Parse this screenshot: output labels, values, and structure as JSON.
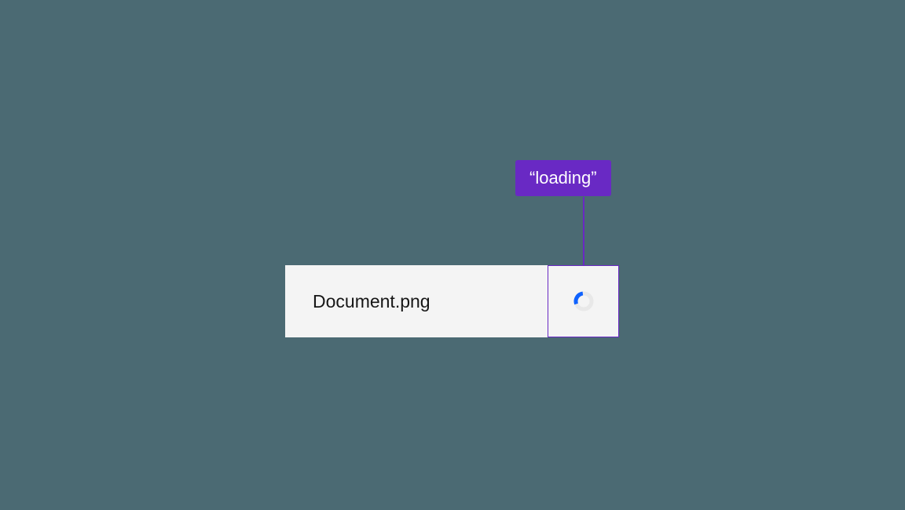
{
  "file": {
    "name": "Document.png"
  },
  "callout": {
    "label": "“loading”"
  },
  "colors": {
    "accent": "#6929c4",
    "spinner": "#0f62fe",
    "background": "#4b6a73",
    "panel": "#f4f4f4"
  }
}
